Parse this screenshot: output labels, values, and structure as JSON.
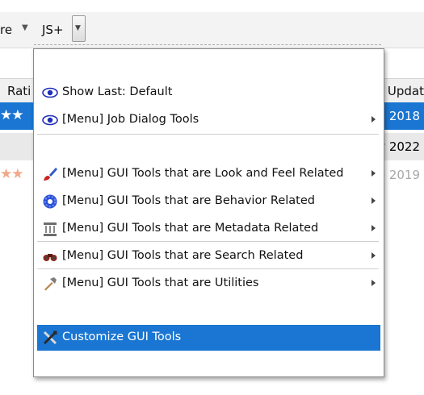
{
  "toolbar": {
    "partial_label": "re",
    "js_label": "JS+"
  },
  "table": {
    "headers": {
      "rating": "Rati",
      "updated": "r Updat"
    },
    "rows": [
      {
        "stars": "★★",
        "date": "n 2018"
      },
      {
        "stars": "",
        "date": "v 2022"
      },
      {
        "stars": "★★",
        "date": "b 2019"
      }
    ]
  },
  "menu": {
    "show_last": "Show Last: Default",
    "job_dialog_tools": "[Menu] Job Dialog Tools",
    "look_and_feel": "[Menu] GUI Tools that are Look and Feel Related",
    "behavior": "[Menu] GUI Tools that are Behavior Related",
    "metadata": "[Menu] GUI Tools that are Metadata Related",
    "search": "[Menu] GUI Tools that are Search Related",
    "utilities": "[Menu] GUI Tools that are Utilities",
    "customize": "Customize GUI Tools"
  },
  "icons": {
    "show_last": "eye-icon",
    "job_dialog_tools": "eye-icon",
    "look_and_feel": "paintbrush-icon",
    "behavior": "gear-icon",
    "metadata": "column-icon",
    "search": "binoculars-icon",
    "utilities": "hammer-icon",
    "customize": "tools-icon"
  },
  "colors": {
    "highlight": "#1a76d2",
    "star": "#f2a88a"
  }
}
